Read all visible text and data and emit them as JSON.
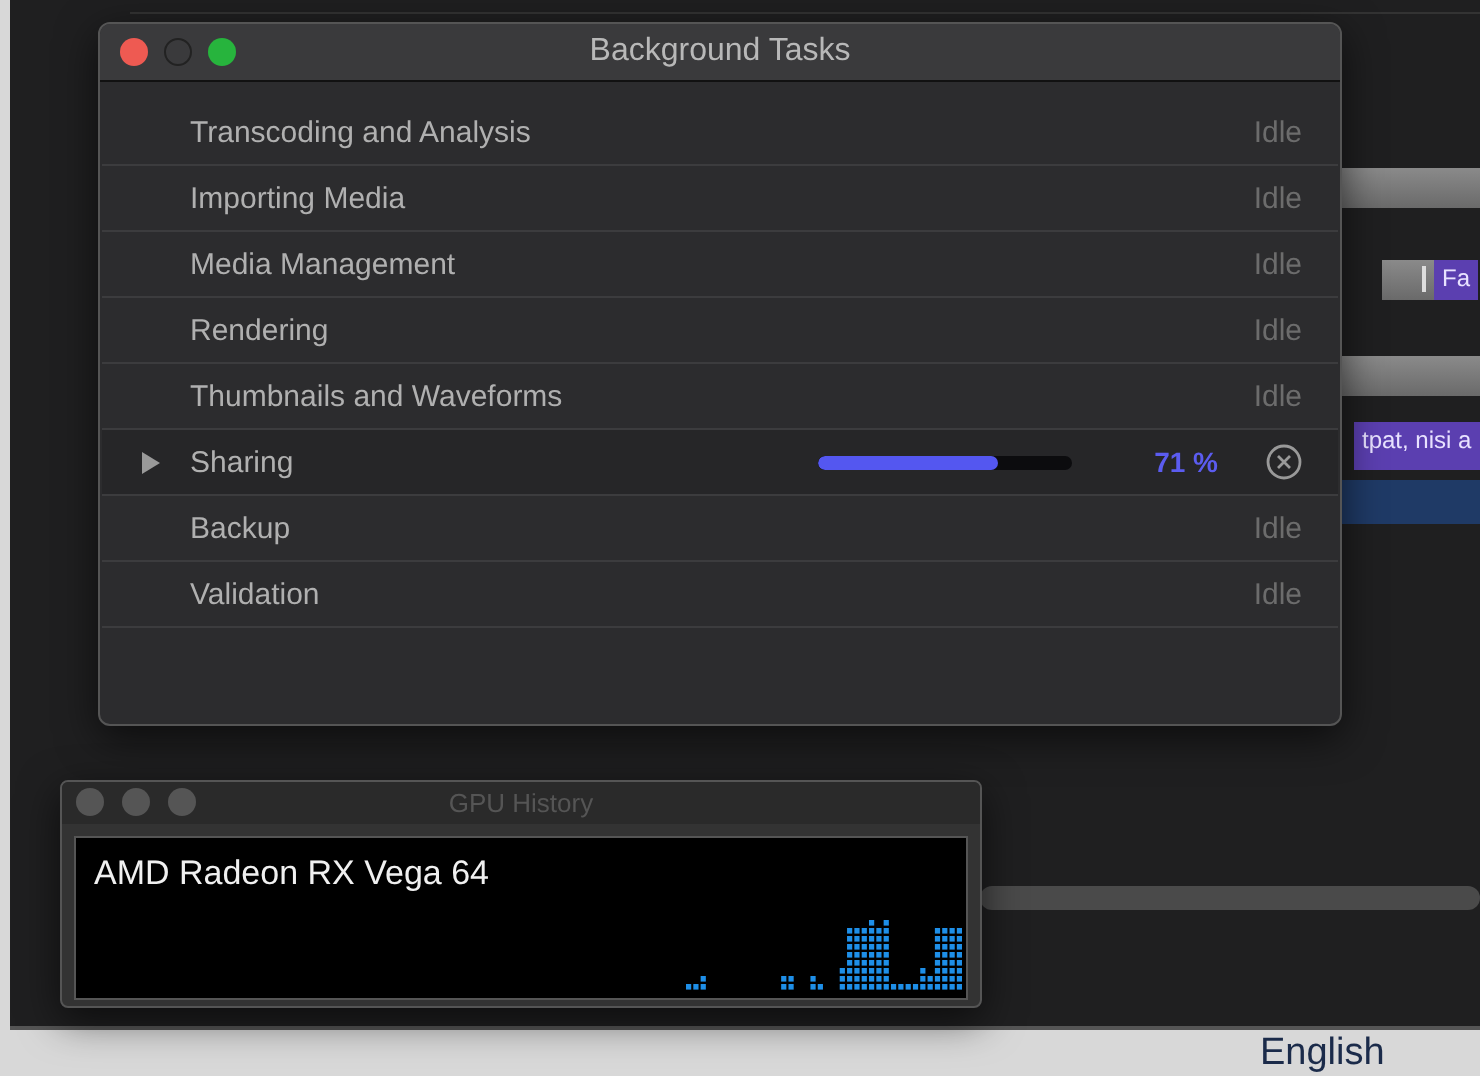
{
  "background": {
    "clips": [
      {
        "label": "Fa",
        "kind": "short"
      },
      {
        "label": "tpat, nisi a",
        "kind": "long"
      }
    ],
    "footer_text": "English"
  },
  "tasks_window": {
    "title": "Background Tasks",
    "tasks": [
      {
        "name": "Transcoding and Analysis",
        "kind": "idle",
        "status": "Idle"
      },
      {
        "name": "Importing Media",
        "kind": "idle",
        "status": "Idle"
      },
      {
        "name": "Media Management",
        "kind": "idle",
        "status": "Idle"
      },
      {
        "name": "Rendering",
        "kind": "idle",
        "status": "Idle"
      },
      {
        "name": "Thumbnails and Waveforms",
        "kind": "idle",
        "status": "Idle"
      },
      {
        "name": "Sharing",
        "kind": "progress",
        "expanded": false,
        "level": 0.71,
        "reading": "71 %"
      },
      {
        "name": "Backup",
        "kind": "idle",
        "status": "Idle"
      },
      {
        "name": "Validation",
        "kind": "idle",
        "status": "Idle"
      }
    ]
  },
  "gpu_window": {
    "title": "GPU History",
    "gpu_name": "AMD Radeon RX Vega 64"
  }
}
